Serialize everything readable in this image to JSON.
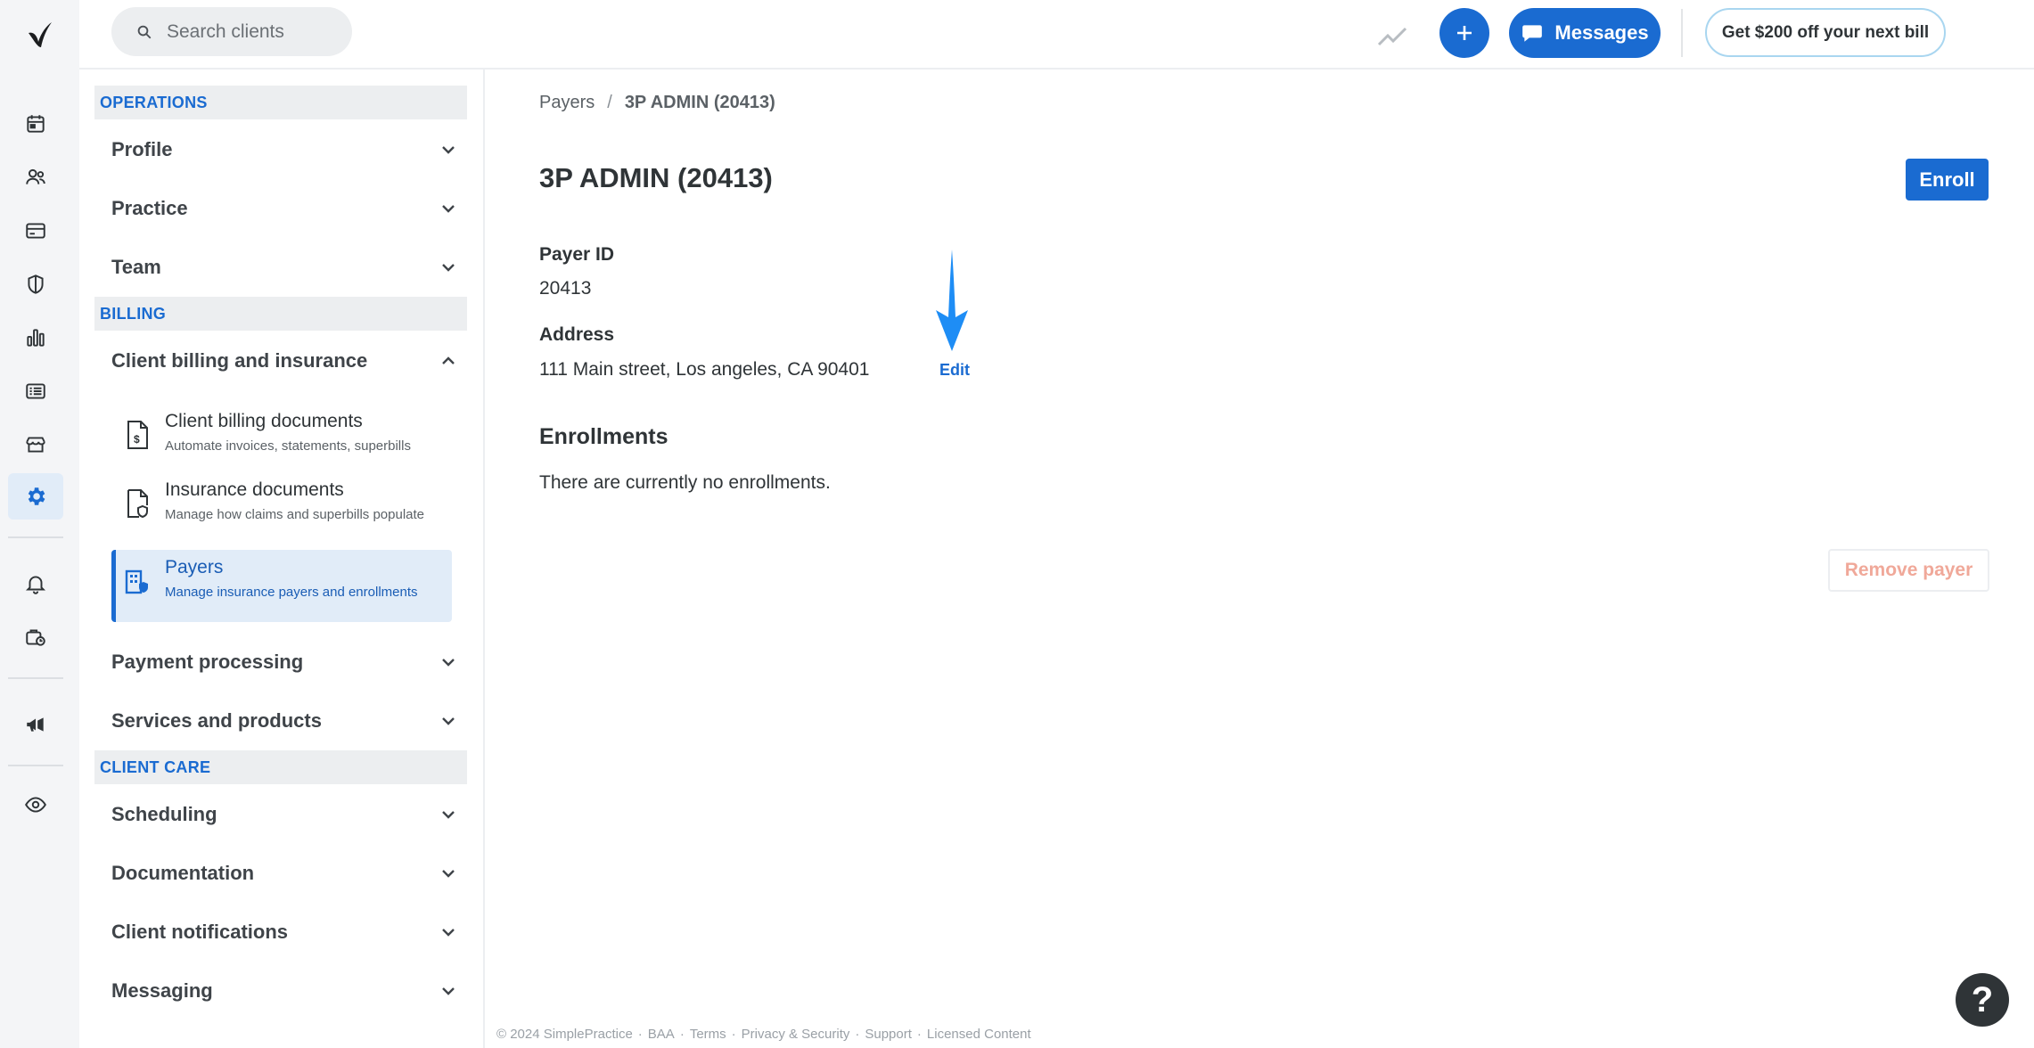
{
  "brand": {
    "accent": "#1a6bd1",
    "logo_color": "#1b3d35",
    "alert": "#f0a899"
  },
  "rail": {
    "items": [
      {
        "icon": "calendar-icon"
      },
      {
        "icon": "clients-icon"
      },
      {
        "icon": "billing-card-icon"
      },
      {
        "icon": "insurance-shield-icon"
      },
      {
        "icon": "analytics-icon"
      },
      {
        "icon": "activity-list-icon"
      },
      {
        "icon": "marketplace-icon"
      },
      {
        "icon": "settings-gear-icon"
      },
      {
        "icon": "notifications-bell-icon"
      },
      {
        "icon": "reminders-icon"
      },
      {
        "icon": "announcements-icon"
      },
      {
        "icon": "eye-icon"
      }
    ]
  },
  "topbar": {
    "search_placeholder": "Search clients",
    "messages_label": "Messages",
    "promo_label": "Get $200 off your next bill"
  },
  "sidebar": {
    "operations_header": "OPERATIONS",
    "billing_header": "BILLING",
    "client_care_header": "CLIENT CARE",
    "profile": "Profile",
    "practice": "Practice",
    "team": "Team",
    "client_billing_insurance": "Client billing and insurance",
    "sub_items": [
      {
        "title": "Client billing documents",
        "desc": "Automate invoices, statements, superbills"
      },
      {
        "title": "Insurance documents",
        "desc": "Manage how claims and superbills populate"
      },
      {
        "title": "Payers",
        "desc": "Manage insurance payers and enrollments"
      }
    ],
    "payment_processing": "Payment processing",
    "services_products": "Services and products",
    "scheduling": "Scheduling",
    "documentation": "Documentation",
    "client_notifications": "Client notifications",
    "messaging": "Messaging"
  },
  "main": {
    "breadcrumb_root": "Payers",
    "breadcrumb_sep": "/",
    "breadcrumb_current": "3P ADMIN (20413)",
    "title": "3P ADMIN (20413)",
    "enroll_label": "Enroll",
    "payer_id_label": "Payer ID",
    "payer_id_value": "20413",
    "address_label": "Address",
    "address_value": "111 Main street, Los angeles, CA 90401",
    "edit_label": "Edit",
    "enrollments_heading": "Enrollments",
    "enrollments_empty": "There are currently no enrollments.",
    "remove_label": "Remove payer"
  },
  "footer": {
    "copyright": "© 2024 SimplePractice",
    "links": [
      "BAA",
      "Terms",
      "Privacy & Security",
      "Support",
      "Licensed Content"
    ]
  },
  "help_label": "?"
}
